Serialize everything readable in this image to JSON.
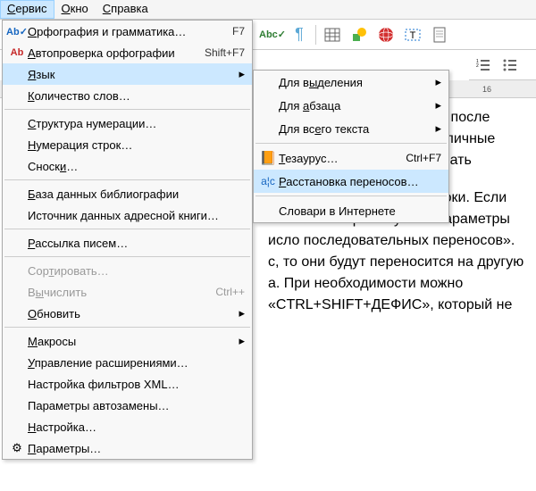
{
  "menubar": {
    "service": "Сервис",
    "window": "Окно",
    "help": "Справка"
  },
  "toolbar": {
    "spellcheck": "Abc",
    "pilcrow": "¶"
  },
  "ruler": {
    "n16": "16"
  },
  "dropdown": {
    "spelling": "Орфография и грамматика…",
    "spelling_sc": "F7",
    "autospell": "Автопроверка орфографии",
    "autospell_sc": "Shift+F7",
    "language": "Язык",
    "wordcount": "Количество слов…",
    "numbering": "Структура нумерации…",
    "linenum": "Нумерация строк…",
    "footnotes": "Сноски…",
    "biblio": "База данных библиографии",
    "addrbook": "Источник данных адресной книги…",
    "mailmerge": "Рассылка писем…",
    "sort": "Сортировать…",
    "calc": "Вычислить",
    "calc_sc": "Ctrl++",
    "update": "Обновить",
    "macros": "Макросы",
    "extmgr": "Управление расширениями…",
    "xmlfilter": "Настройка фильтров XML…",
    "autocorrect": "Параметры автозамены…",
    "customize": "Настройка…",
    "options": "Параметры…"
  },
  "submenu": {
    "for_selection": "Для выделения",
    "for_paragraph": "Для абзаца",
    "for_all": "Для всего текста",
    "thesaurus": "Тезаурус…",
    "thesaurus_sc": "Ctrl+F7",
    "hyphenation": "Расстановка переносов…",
    "dictionaries": "Словари в Интернете"
  },
  "doc": {
    "p1a": "рде вручную можно только после",
    "p1b": "ению Word предлагает различные",
    "p1c": "в котором необходимо указать",
    "p2a": "чаться в конце каждой строки. Если",
    "p2b": "еносов» выбрать пункт «Параметры",
    "p2c": "исло последовательных переносов».",
    "p2d": "с, то они будут переносится на другую",
    "p2e": "а. При необходимости можно",
    "p2f": "«CTRL+SHIFT+ДЕФИС», который не"
  }
}
